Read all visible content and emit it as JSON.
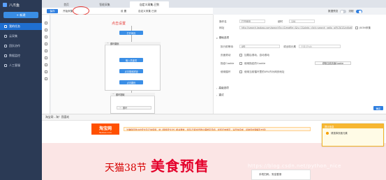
{
  "app": {
    "title": "八爪鱼"
  },
  "sidebar": {
    "new_label": "+ 新建",
    "items": [
      {
        "label": "我的任务"
      },
      {
        "label": "云采集"
      },
      {
        "label": "团队协作"
      },
      {
        "label": "数据监控"
      },
      {
        "label": "人工客服"
      }
    ]
  },
  "tabs": [
    {
      "label": "首页"
    },
    {
      "label": "智能采集"
    },
    {
      "label": "自定义采集-已到"
    }
  ],
  "toolbar": {
    "save_label": "保存",
    "start_label": "开始采集",
    "settings_label": "设 置",
    "custom_label": "自定义采集 已到"
  },
  "right_tools": {
    "view_label": "数据预览",
    "flow_label": "流程"
  },
  "canvas": {
    "hint": "点击设置",
    "nodes": [
      {
        "label": "打开网页"
      },
      {
        "label": "循环翻页"
      },
      {
        "label": "输入关键词"
      },
      {
        "label": "点击搜索按钮"
      },
      {
        "label": "点击翻页"
      },
      {
        "label": "循环提取"
      },
      {
        "label": "循环"
      }
    ]
  },
  "props": {
    "op_name_label": "操作名",
    "op_name_value": "打开网页",
    "timeout_label": "超时",
    "timeout_value": "120",
    "url_label": "网址",
    "url_value": "http://search.taobao.com/search?q=&imgfile=&js=1&stats_click=search_radio_all%3A1&initiative_id=",
    "json_label": "JSON采集",
    "basic_section": "基础选项",
    "exec_label": "执行前等待",
    "exec_value": "0秒",
    "exec_wait_label": "或出现元素",
    "exec_wait_placeholder": "元素XPath",
    "scroll_label": "页面滚动",
    "scroll_value": "加载后滚动，自动滚动",
    "cookie_label": "指定Cookie",
    "cookie_value": "使用指定的Cookie",
    "cookie_btn": "获取当前页面Cookie",
    "proxy_label": "使用循环",
    "proxy_value": "使用当前循环里的URL作为网页地址",
    "adv_section": "高级选项",
    "retry_section": "重试",
    "ok_label": "确定"
  },
  "browser": {
    "address": "淘宝网 - 淘！我喜欢",
    "logo_big": "淘宝网",
    "logo_small": "Taobao.com",
    "notice": "为确保您账户的安全及正常使用，依《网络安全法》相关要求，6月1日起会员账户需绑定手机，如您还未绑定，请尽快完成，感谢您的理解及支持！",
    "banner_brand": "天猫38节",
    "banner_main": "美食预售",
    "watermark": "https://blog.csdn.net/python_nice",
    "login_label": "手机扫码，安全登录"
  },
  "popup": {
    "title": "提示信息",
    "message": "请选择页面元素"
  }
}
